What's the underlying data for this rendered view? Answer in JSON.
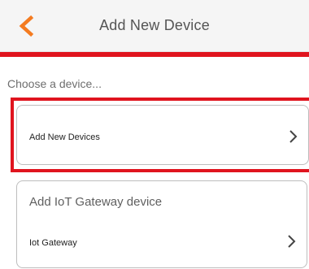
{
  "header": {
    "title": "Add New Device",
    "back_icon": "chevron-left-icon",
    "accent_color": "#f47b20"
  },
  "brand_color": "#e0141e",
  "section": {
    "label": "Choose a device..."
  },
  "cards": [
    {
      "title": "",
      "subtitle": "Add New Devices",
      "icon": "chevron-right-icon"
    },
    {
      "title": "Add IoT Gateway device",
      "subtitle": "Iot Gateway",
      "icon": "chevron-right-icon"
    }
  ]
}
